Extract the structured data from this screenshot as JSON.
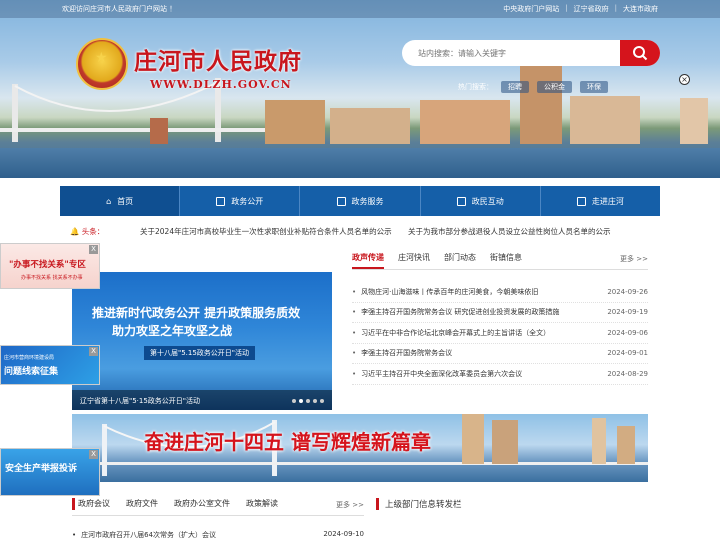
{
  "topbar": {
    "welcome": "欢迎访问庄河市人民政府门户网站 ！",
    "links": [
      "中央政府门户网站",
      "辽宁省政府",
      "大连市政府"
    ]
  },
  "header": {
    "title": "庄河市人民政府",
    "url": "WWW.DLZH.GOV.CN",
    "search_placeholder": "站内搜索：请输入关键字",
    "hot_label": "热门搜索：",
    "hot_tags": [
      "招聘",
      "公积金",
      "环保"
    ]
  },
  "nav": {
    "items": [
      "首页",
      "政务公开",
      "政务服务",
      "政民互动",
      "走进庄河"
    ]
  },
  "headline": {
    "label": "头条：",
    "items": [
      "关于2024年庄河市高校毕业生一次性求职创业补贴符合条件人员名单的公示",
      "关于为我市部分参战退役人员设立公益性岗位人员名单的公示"
    ]
  },
  "slider": {
    "section_title": "庄河",
    "line1": "推进新时代政务公开  提升政策服务质效",
    "line2": "助力攻坚之年攻坚之战",
    "line3": "第十八届\"5.15政务公开日\"活动",
    "caption": "辽宁省第十八届\"5·15政务公开日\"活动"
  },
  "news": {
    "tabs": [
      "政声传递",
      "庄河快讯",
      "部门动态",
      "街镇信息"
    ],
    "more": "更多 >>",
    "rows": [
      {
        "title": "风物庄河·山海滋味丨传承百年的庄河美食，今朝美味依旧",
        "date": "2024-09-26"
      },
      {
        "title": "李强主持召开国务院常务会议 研究促进创业投资发展的政策措施",
        "date": "2024-09-19"
      },
      {
        "title": "习近平在中非合作论坛北京峰会开幕式上的主旨讲话（全文）",
        "date": "2024-09-06"
      },
      {
        "title": "李强主持召开国务院常务会议",
        "date": "2024-09-01"
      },
      {
        "title": "习近平主持召开中央全面深化改革委员会第六次会议",
        "date": "2024-08-29"
      }
    ]
  },
  "promo": {
    "text": "奋进庄河十四五  谱写辉煌新篇章"
  },
  "bottom": {
    "tabs": [
      "政府会议",
      "政府文件",
      "政府办公室文件",
      "政策解读"
    ],
    "more": "更多 >>",
    "right_title": "上级部门信息转发栏",
    "row": {
      "title": "庄河市政府召开八届64次常务（扩大）会议",
      "date": "2024-09-10"
    }
  },
  "floats": {
    "f1_title": "\"办事不找关系\"专区",
    "f1_sub": "办事不找关系 找关系不办事",
    "f2_sub": "庄河市营商环境建设局",
    "f2_title": "问题线索征集",
    "f3_title": "安全生产举报投诉",
    "close": "X"
  },
  "colors": {
    "brand_red": "#c8161d",
    "nav_blue": "#155fa8"
  }
}
